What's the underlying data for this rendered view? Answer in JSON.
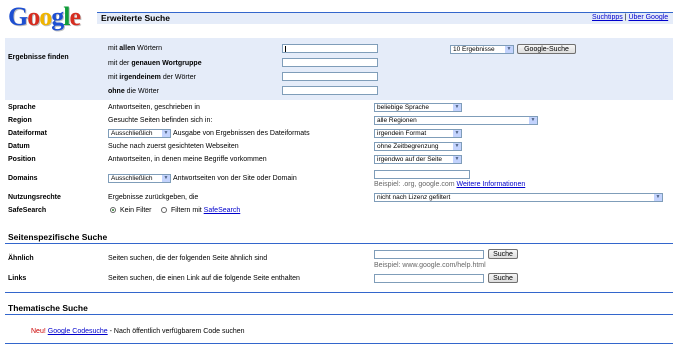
{
  "logo": {
    "text": "Google",
    "letters": [
      {
        "ch": "G",
        "color": "#1e4fd1"
      },
      {
        "ch": "o",
        "color": "#d62d20"
      },
      {
        "ch": "o",
        "color": "#f0b400"
      },
      {
        "ch": "g",
        "color": "#1e4fd1"
      },
      {
        "ch": "l",
        "color": "#109d3a"
      },
      {
        "ch": "e",
        "color": "#d62d20"
      }
    ]
  },
  "header": {
    "title": "Erweiterte Suche",
    "link_tips": "Suchtipps",
    "separator": "|",
    "link_about": "Über Google"
  },
  "find": {
    "section_label": "Ergebnisse finden",
    "all": {
      "pre": "mit ",
      "bold": "allen",
      "post": " Wörtern"
    },
    "phrase": {
      "pre": "mit der ",
      "bold": "genauen Wortgruppe",
      "post": ""
    },
    "any": {
      "pre": "mit ",
      "bold": "irgendeinem",
      "post": " der Wörter"
    },
    "none": {
      "pre": "",
      "bold": "ohne",
      "post": " die Wörter"
    },
    "results_select": "10 Ergebnisse",
    "search_button": "Google-Suche"
  },
  "rows": {
    "language": {
      "label": "Sprache",
      "desc": "Antwortseiten, geschrieben in",
      "select": "beliebige Sprache"
    },
    "region": {
      "label": "Region",
      "desc": "Gesuchte Seiten befinden sich in:",
      "select": "alle Regionen"
    },
    "fileformat": {
      "label": "Dateiformat",
      "mode": "Ausschließlich",
      "desc": "Ausgabe von Ergebnissen des Dateiformats",
      "select": "irgendein Format"
    },
    "date": {
      "label": "Datum",
      "desc": "Suche nach zuerst gesichteten Webseiten",
      "select": "ohne Zeitbegrenzung"
    },
    "position": {
      "label": "Position",
      "desc": "Antwortseiten, in denen meine Begriffe vorkommen",
      "select": "irgendwo auf der Seite"
    },
    "domains": {
      "label": "Domains",
      "mode": "Ausschließlich",
      "desc": "Antwortseiten von der Site oder Domain",
      "example": "Beispiel: .org, google.com",
      "more": "Weitere Informationen"
    },
    "usage": {
      "label": "Nutzungsrechte",
      "desc": "Ergebnisse zurückgeben, die",
      "select": "nicht nach Lizenz gefiltert"
    },
    "safesearch": {
      "label": "SafeSearch",
      "opt1": "Kein Filter",
      "opt2_pre": "Filtern mit ",
      "opt2_link": "SafeSearch"
    }
  },
  "page_specific": {
    "heading": "Seitenspezifische Suche",
    "similar": {
      "label": "Ähnlich",
      "desc": "Seiten suchen, die der folgenden Seite ähnlich sind",
      "button": "Suche",
      "example": "Beispiel: www.google.com/help.html"
    },
    "links": {
      "label": "Links",
      "desc": "Seiten suchen, die einen Link auf die folgende Seite enthalten",
      "button": "Suche"
    }
  },
  "topic": {
    "heading": "Thematische Suche",
    "new": "Neu!",
    "link": "Google Codesuche",
    "desc": " - Nach öffentlich verfügbarem Code suchen"
  }
}
